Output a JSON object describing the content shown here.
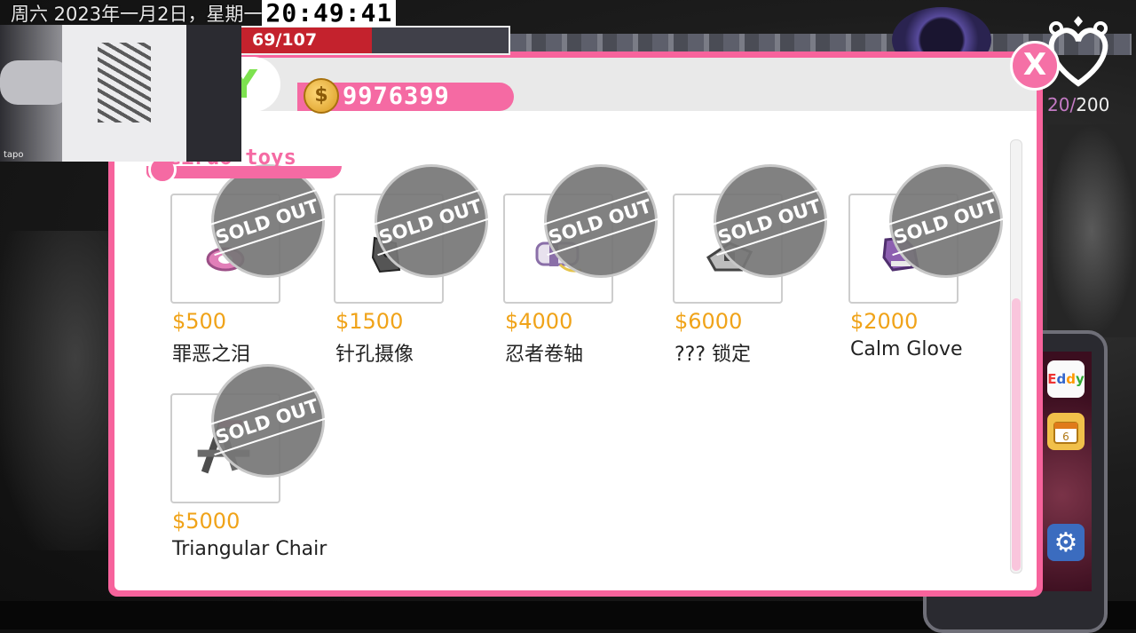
{
  "overlay": {
    "date_text": "周六 2023年一月2日，星期一",
    "clock": "20:49:41",
    "hp_text": "69/107",
    "hp_fraction": 0.49,
    "webcam_logo": "tapo"
  },
  "status": {
    "heart_current": "20/",
    "heart_max": "200"
  },
  "shop": {
    "logo_letter": "Y",
    "money": "9976399",
    "coin_symbol": "$",
    "title": "weirdo toys",
    "close_label": "X",
    "sold_out_label": "SOLD OUT",
    "items": [
      {
        "price": "$500",
        "name": "罪恶之泪",
        "icon": "pink-eye-ring-icon"
      },
      {
        "price": "$1500",
        "name": "针孔摄像",
        "icon": "pinhole-camera-icon"
      },
      {
        "price": "$4000",
        "name": "忍者卷轴",
        "icon": "ninja-scroll-icon"
      },
      {
        "price": "$6000",
        "name": "??? 锁定",
        "icon": "locked-device-icon"
      },
      {
        "price": "$2000",
        "name": "Calm Glove",
        "icon": "glove-icon"
      },
      {
        "price": "$5000",
        "name": "Triangular Chair",
        "icon": "chair-icon"
      }
    ]
  },
  "phone": {
    "apps": [
      {
        "label": "Eddy",
        "icon": "eddy-app-icon"
      },
      {
        "label": "6",
        "icon": "calendar-icon"
      },
      {
        "label": "⚙",
        "icon": "gear-icon"
      }
    ]
  },
  "colors": {
    "accent_pink": "#f56aa3",
    "price_orange": "#f0a319",
    "hp_red": "#c4222d"
  }
}
